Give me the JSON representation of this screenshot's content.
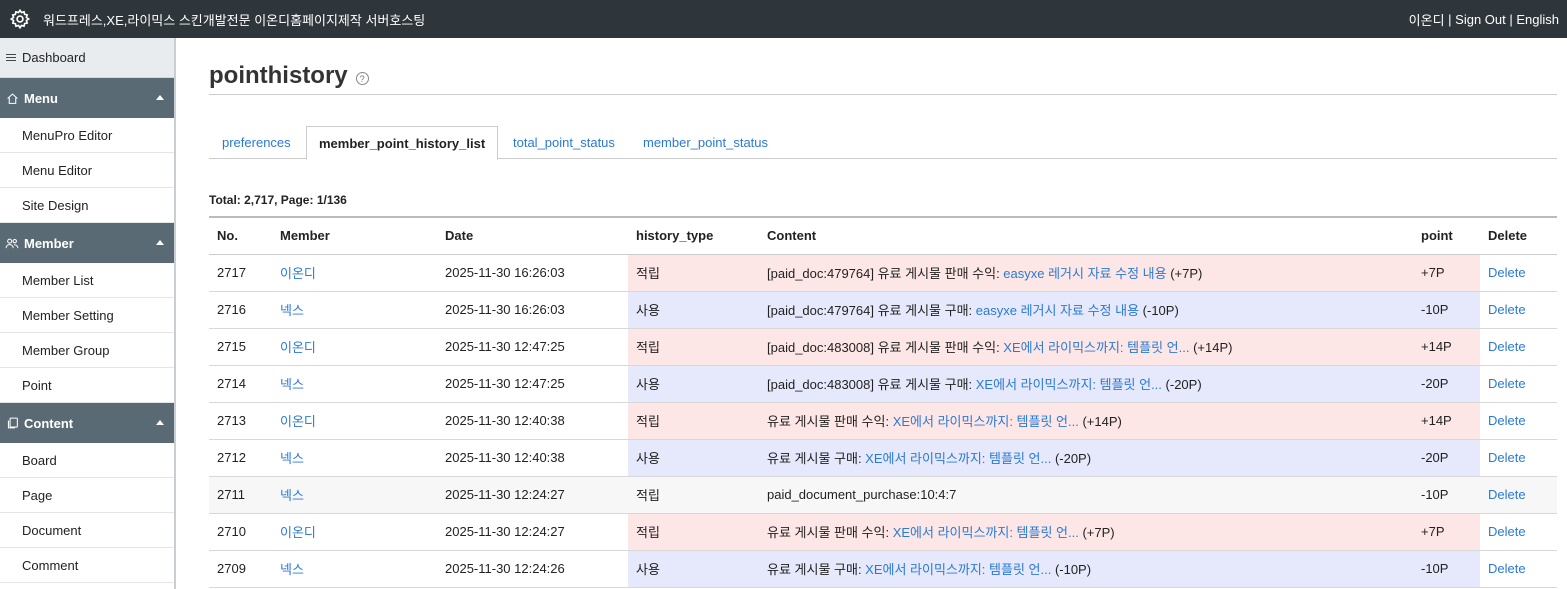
{
  "topbar": {
    "site_title": "워드프레스,XE,라이믹스 스킨개발전문 이온디홈페이지제작 서버호스팅",
    "user": "이온디",
    "sep1": " | ",
    "sign_out": "Sign Out",
    "sep2": " | ",
    "language": "English"
  },
  "sidebar": {
    "dashboard": "Dashboard",
    "groups": [
      {
        "label": "Menu",
        "icon": "home-icon",
        "items": [
          "MenuPro Editor",
          "Menu Editor",
          "Site Design"
        ]
      },
      {
        "label": "Member",
        "icon": "users-icon",
        "items": [
          "Member List",
          "Member Setting",
          "Member Group",
          "Point"
        ]
      },
      {
        "label": "Content",
        "icon": "copy-icon",
        "items": [
          "Board",
          "Page",
          "Document",
          "Comment"
        ]
      }
    ]
  },
  "page": {
    "title": "pointhistory",
    "help": "?"
  },
  "tabs": [
    "preferences",
    "member_point_history_list",
    "total_point_status",
    "member_point_status"
  ],
  "summary": "Total: 2,717, Page: 1/136",
  "table": {
    "headers": [
      "No.",
      "Member",
      "Date",
      "history_type",
      "Content",
      "point",
      "Delete"
    ],
    "rows": [
      {
        "no": "2717",
        "member": "이온디",
        "date": "2025-11-30 16:26:03",
        "type": "적립",
        "kind": "earn",
        "prefix": "[paid_doc:479764] 유료 게시물 판매 수익: ",
        "link": "easyxe 레거시 자료 수정 내용",
        "suffix": " (+7P)",
        "point": "+7P",
        "delete": "Delete"
      },
      {
        "no": "2716",
        "member": "넥스",
        "date": "2025-11-30 16:26:03",
        "type": "사용",
        "kind": "use",
        "prefix": "[paid_doc:479764] 유료 게시물 구매: ",
        "link": "easyxe 레거시 자료 수정 내용",
        "suffix": " (-10P)",
        "point": "-10P",
        "delete": "Delete"
      },
      {
        "no": "2715",
        "member": "이온디",
        "date": "2025-11-30 12:47:25",
        "type": "적립",
        "kind": "earn",
        "prefix": "[paid_doc:483008] 유료 게시물 판매 수익: ",
        "link": "XE에서 라이믹스까지: 템플릿 언...",
        "suffix": " (+14P)",
        "point": "+14P",
        "delete": "Delete"
      },
      {
        "no": "2714",
        "member": "넥스",
        "date": "2025-11-30 12:47:25",
        "type": "사용",
        "kind": "use",
        "prefix": "[paid_doc:483008] 유료 게시물 구매: ",
        "link": "XE에서 라이믹스까지: 템플릿 언...",
        "suffix": " (-20P)",
        "point": "-20P",
        "delete": "Delete"
      },
      {
        "no": "2713",
        "member": "이온디",
        "date": "2025-11-30 12:40:38",
        "type": "적립",
        "kind": "earn",
        "prefix": "유료 게시물 판매 수익: ",
        "link": "XE에서 라이믹스까지: 템플릿 언...",
        "suffix": " (+14P)",
        "point": "+14P",
        "delete": "Delete"
      },
      {
        "no": "2712",
        "member": "넥스",
        "date": "2025-11-30 12:40:38",
        "type": "사용",
        "kind": "use",
        "prefix": "유료 게시물 구매: ",
        "link": "XE에서 라이믹스까지: 템플릿 언...",
        "suffix": " (-20P)",
        "point": "-20P",
        "delete": "Delete"
      },
      {
        "no": "2711",
        "member": "넥스",
        "date": "2025-11-30 12:24:27",
        "type": "적립",
        "kind": "plain",
        "prefix": "paid_document_purchase:10:4:7",
        "link": "",
        "suffix": "",
        "point": "-10P",
        "delete": "Delete"
      },
      {
        "no": "2710",
        "member": "이온디",
        "date": "2025-11-30 12:24:27",
        "type": "적립",
        "kind": "earn",
        "prefix": "유료 게시물 판매 수익: ",
        "link": "XE에서 라이믹스까지: 템플릿 언...",
        "suffix": " (+7P)",
        "point": "+7P",
        "delete": "Delete"
      },
      {
        "no": "2709",
        "member": "넥스",
        "date": "2025-11-30 12:24:26",
        "type": "사용",
        "kind": "use",
        "prefix": "유료 게시물 구매: ",
        "link": "XE에서 라이믹스까지: 템플릿 언...",
        "suffix": " (-10P)",
        "point": "-10P",
        "delete": "Delete"
      }
    ]
  }
}
